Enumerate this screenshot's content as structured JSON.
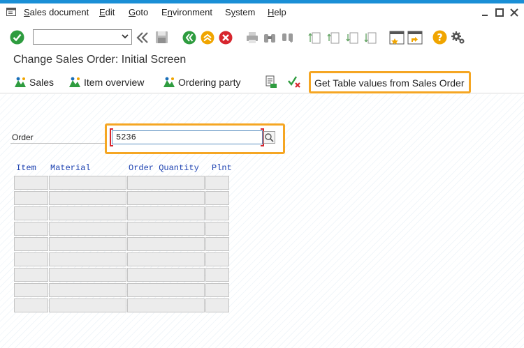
{
  "menu": {
    "items": [
      {
        "label": "Sales document",
        "accel": "S",
        "rest": "ales document"
      },
      {
        "label": "Edit",
        "accel": "E",
        "rest": "dit"
      },
      {
        "label": "Goto",
        "accel": "G",
        "rest": "oto"
      },
      {
        "label": "Environment",
        "accel": "n",
        "pre": "E",
        "rest": "vironment"
      },
      {
        "label": "System",
        "accel": "y",
        "pre": "S",
        "rest": "stem"
      },
      {
        "label": "Help",
        "accel": "H",
        "rest": "elp"
      }
    ]
  },
  "toolbar": {
    "command_field_value": "",
    "icons": [
      "enter-icon",
      "back-double-chevron-icon",
      "save-icon",
      "back-icon",
      "exit-icon",
      "cancel-icon",
      "print-icon",
      "find-icon",
      "find-next-icon",
      "first-page-icon",
      "previous-page-icon",
      "next-page-icon",
      "last-page-icon",
      "new-session-icon",
      "shortcut-icon",
      "help-icon",
      "settings-icon"
    ]
  },
  "page": {
    "title": "Change Sales Order: Initial Screen"
  },
  "app_toolbar": {
    "sales": "Sales",
    "item_overview": "Item overview",
    "ordering_party": "Ordering party",
    "get_table_values": "Get Table values from Sales Order"
  },
  "form": {
    "order_label": "Order",
    "order_value": "5236"
  },
  "table": {
    "headers": [
      "Item",
      "Material",
      "Order Quantity",
      "Plnt"
    ],
    "rows": [
      [
        "",
        "",
        "",
        ""
      ],
      [
        "",
        "",
        "",
        ""
      ],
      [
        "",
        "",
        "",
        ""
      ],
      [
        "",
        "",
        "",
        ""
      ],
      [
        "",
        "",
        "",
        ""
      ],
      [
        "",
        "",
        "",
        ""
      ],
      [
        "",
        "",
        "",
        ""
      ],
      [
        "",
        "",
        "",
        ""
      ],
      [
        "",
        "",
        "",
        ""
      ]
    ]
  },
  "colors": {
    "accent": "#1a8fd6",
    "highlight": "#f5a623",
    "ok_green": "#2e9c3f",
    "cancel_red": "#d7262e",
    "header_blue": "#1a3fb0"
  }
}
